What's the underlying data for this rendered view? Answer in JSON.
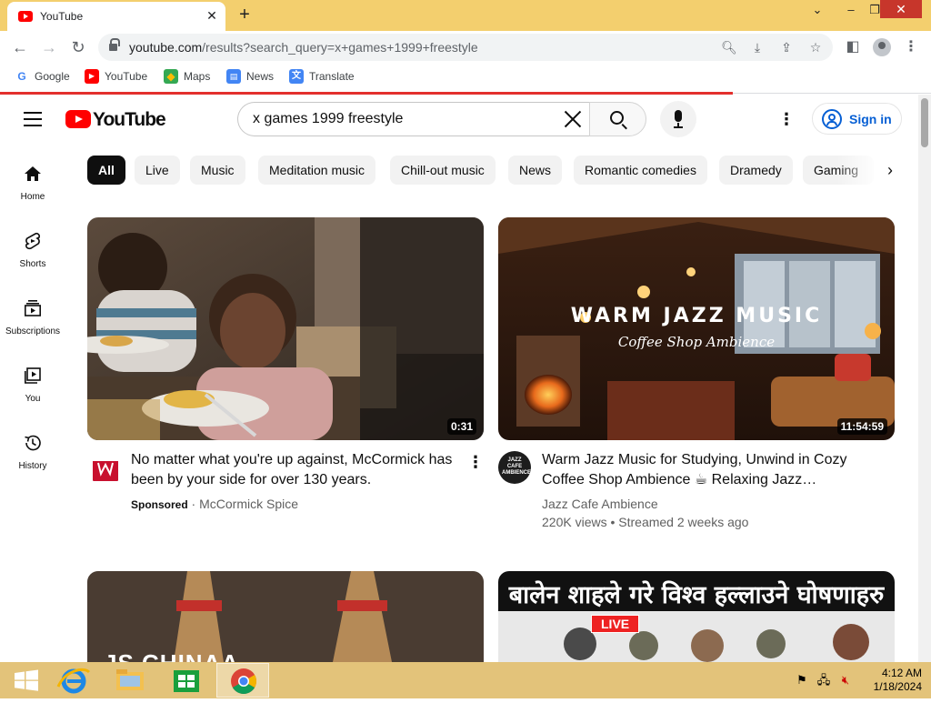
{
  "browser": {
    "tab_title": "YouTube",
    "url_host": "youtube.com",
    "url_path": "/results?search_query=x+games+1999+freestyle",
    "bookmarks": [
      "Google",
      "YouTube",
      "Maps",
      "News",
      "Translate"
    ]
  },
  "youtube": {
    "logo_text": "YouTube",
    "search_query": "x games 1999 freestyle",
    "signin_label": "Sign in",
    "nav": [
      "Home",
      "Shorts",
      "Subscriptions",
      "You",
      "History"
    ],
    "chips": [
      "All",
      "Live",
      "Music",
      "Meditation music",
      "Chill-out music",
      "News",
      "Romantic comedies",
      "Dramedy",
      "Gaming"
    ],
    "videos": [
      {
        "title": "No matter what you're up against, McCormick has been by your side for over 130 years.",
        "duration": "0:31",
        "sponsored_label": "Sponsored",
        "channel": "McCormick Spice"
      },
      {
        "title": "Warm Jazz Music for Studying, Unwind in Cozy Coffee Shop Ambience ☕ Relaxing Jazz…",
        "duration": "11:54:59",
        "channel": "Jazz Cafe Ambience",
        "meta": "220K views • Streamed 2 weeks ago",
        "thumb_title": "WARM JAZZ MUSIC",
        "thumb_subtitle": "Coffee Shop Ambience",
        "avatar_text": "JAZZ CAFE AMBIENCE"
      },
      {
        "thumb_text": "JS CHINAA"
      },
      {
        "thumb_headline": "बालेन शाहले गरे विश्व हल्लाउने घोषणाहरु",
        "live_label": "LIVE"
      }
    ]
  },
  "taskbar": {
    "time": "4:12 AM",
    "date": "1/18/2024"
  }
}
